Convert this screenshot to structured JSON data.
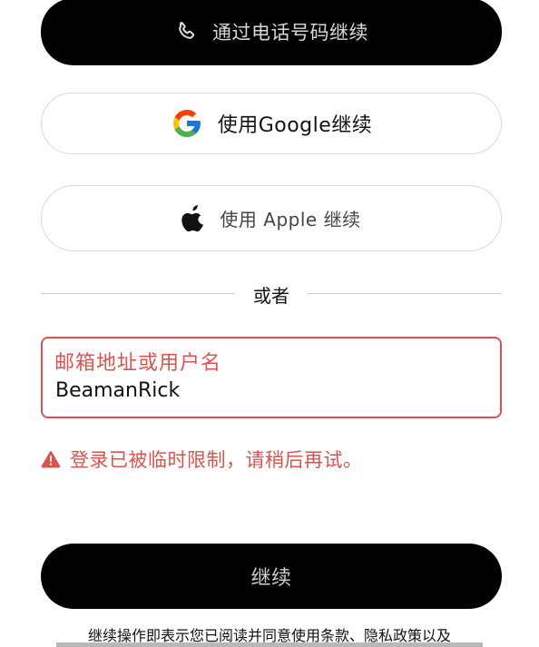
{
  "buttons": {
    "phone_label": "通过电话号码继续",
    "google_label": "使用Google继续",
    "apple_label": "使用 Apple 继续",
    "continue_label": "继续"
  },
  "divider": {
    "text": "或者"
  },
  "email_field": {
    "label": "邮箱地址或用户名",
    "value": "BeamanRick"
  },
  "error": {
    "message": "登录已被临时限制，请稍后再试。"
  },
  "footer": {
    "terms_text": "继续操作即表示您已阅读并同意使用条款、隐私政策以及"
  },
  "icons": {
    "phone": "phone-icon",
    "google": "google-logo-icon",
    "apple": "apple-logo-icon",
    "warning": "warning-icon"
  },
  "colors": {
    "error_red": "#d9534f",
    "button_dark": "#000000",
    "border_light": "#d9d9de"
  }
}
